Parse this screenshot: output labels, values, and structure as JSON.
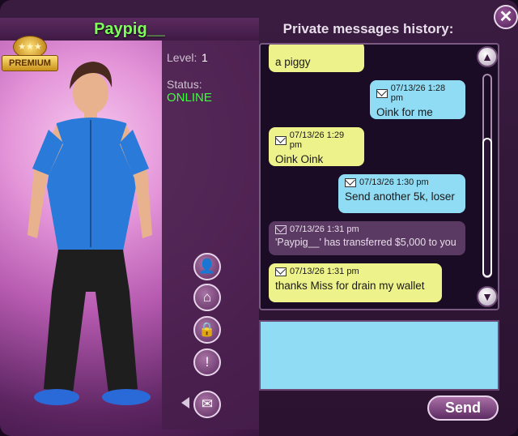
{
  "profile": {
    "username": "Paypig__",
    "badge": "PREMIUM",
    "level_label": "Level:",
    "level_value": "1",
    "status_label": "Status:",
    "status_value": "ONLINE"
  },
  "messages_panel": {
    "title": "Private messages history:"
  },
  "messages": [
    {
      "type": "incoming",
      "timestamp": "",
      "text": "a piggy"
    },
    {
      "type": "outgoing",
      "timestamp": "07/13/26  1:28 pm",
      "text": "Oink for me"
    },
    {
      "type": "incoming",
      "timestamp": "07/13/26  1:29 pm",
      "text": "Oink Oink"
    },
    {
      "type": "outgoing",
      "timestamp": "07/13/26  1:30 pm",
      "text": "Send another 5k, loser"
    },
    {
      "type": "system",
      "timestamp": "07/13/26  1:31 pm",
      "text": "'Paypig__' has transferred $5,000 to you"
    },
    {
      "type": "incoming",
      "timestamp": "07/13/26  1:31 pm",
      "text": "thanks Miss for drain my wallet"
    }
  ],
  "compose": {
    "value": ""
  },
  "buttons": {
    "send": "Send",
    "close": "✕"
  },
  "side_actions": [
    "add-friend-icon",
    "home-heart-icon",
    "lock-icon",
    "report-icon",
    "mail-icon"
  ],
  "colors": {
    "username": "#7dff5a",
    "online": "#3cff3c",
    "incoming_bubble": "#eef28a",
    "outgoing_bubble": "#8fdcf4",
    "system_bubble": "#5a3a62"
  }
}
